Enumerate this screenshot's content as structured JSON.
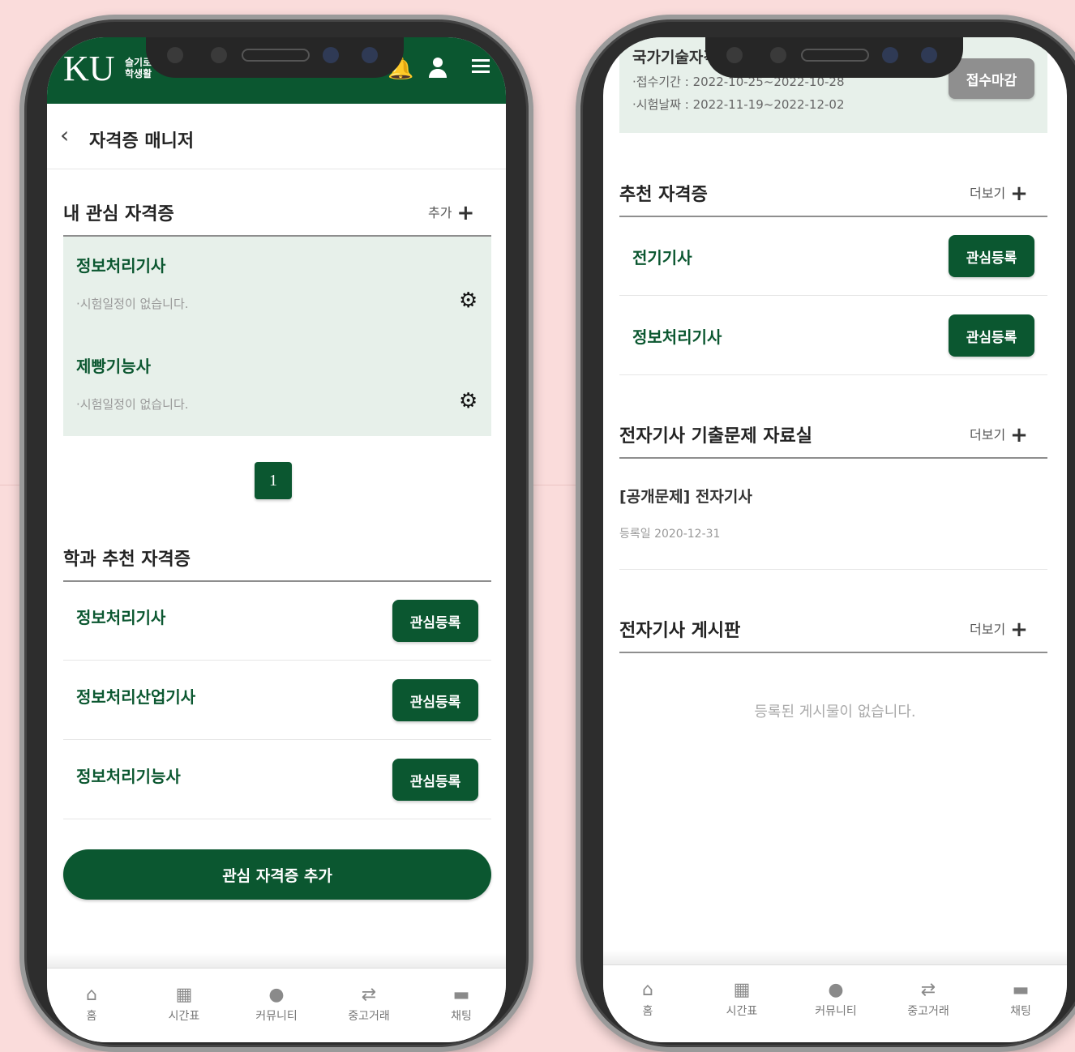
{
  "left": {
    "header": {
      "logo": "KU",
      "logo_sub": "슬기로운 대학생활"
    },
    "page_title": "자격증 매니저",
    "interest": {
      "title": "내 관심 자격증",
      "add_label": "추가",
      "items": [
        {
          "name": "정보처리기사",
          "note": "시험일정이 없습니다."
        },
        {
          "name": "제빵기능사",
          "note": "시험일정이 없습니다."
        }
      ],
      "page": "1"
    },
    "dept": {
      "title": "학과 추천 자격증",
      "items": [
        {
          "name": "정보처리기사",
          "button": "관심등록"
        },
        {
          "name": "정보처리산업기사",
          "button": "관심등록"
        },
        {
          "name": "정보처리기능사",
          "button": "관심등록"
        }
      ]
    },
    "add_button": "관심 자격증 추가"
  },
  "right": {
    "exam": {
      "title": "국가기술자격",
      "apply_period": "접수기간 : 2022-10-25~2022-10-28",
      "exam_date": "시험날짜 : 2022-11-19~2022-12-02",
      "status": "접수마감"
    },
    "recommend": {
      "title": "추천 자격증",
      "more": "더보기",
      "items": [
        {
          "name": "전기기사",
          "button": "관심등록"
        },
        {
          "name": "정보처리기사",
          "button": "관심등록"
        }
      ]
    },
    "archive": {
      "title": "전자기사 기출문제 자료실",
      "more": "더보기",
      "post_title": "[공개문제] 전자기사",
      "post_date": "등록일 2020-12-31"
    },
    "board": {
      "title": "전자기사 게시판",
      "more": "더보기",
      "empty": "등록된 게시물이 없습니다."
    }
  },
  "tabbar": [
    "홈",
    "시간표",
    "커뮤니티",
    "중고거래",
    "채팅"
  ],
  "colors": {
    "brand": "#0b5730",
    "light_bg": "#e7f0ea",
    "background": "#fadcdb"
  }
}
